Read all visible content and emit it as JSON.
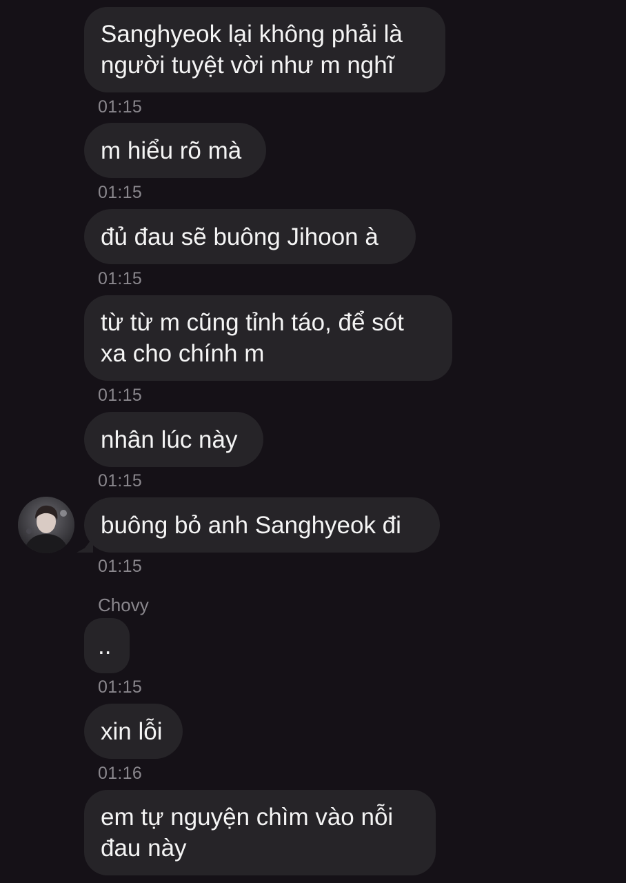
{
  "messages": [
    {
      "text": "Sanghyeok lại không phải là\nngười tuyệt vời như m nghĩ",
      "time": "01:15"
    },
    {
      "text": "m hiểu rõ mà",
      "time": "01:15"
    },
    {
      "text": "đủ đau sẽ buông Jihoon à",
      "time": "01:15"
    },
    {
      "text": "từ từ m cũng tỉnh táo, để sót\nxa cho chính m",
      "time": "01:15"
    },
    {
      "text": "nhân lúc này",
      "time": "01:15"
    },
    {
      "text": "buông bỏ anh Sanghyeok đi",
      "time": "01:15"
    },
    {
      "text": "..",
      "time": "01:15"
    },
    {
      "text": "xin lỗi",
      "time": "01:16"
    },
    {
      "text": "em tự nguyện chìm vào nỗi\nđau này",
      "time": ""
    }
  ],
  "sender_name": "Chovy",
  "colors": {
    "background": "#151117",
    "bubble": "#262428",
    "timestamp": "#8a878d"
  },
  "avatar_icon": "user-avatar-icon"
}
